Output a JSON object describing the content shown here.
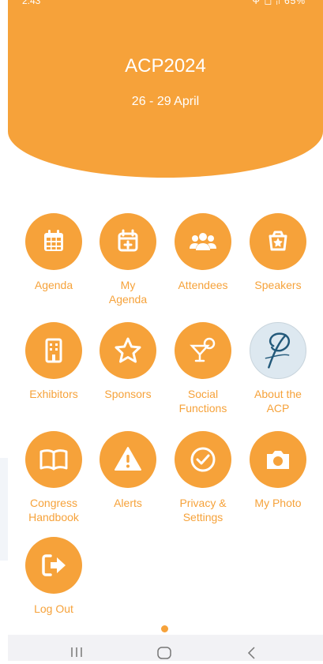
{
  "status_bar": {
    "time": "2:43",
    "right": "Ψ  ◻  ᵢₗ 65%"
  },
  "header": {
    "title": "ACP2024",
    "dates": "26 - 29 April"
  },
  "tiles": [
    {
      "label": "Agenda",
      "icon": "calendar-grid-icon"
    },
    {
      "label": "My\nAgenda",
      "icon": "calendar-plus-icon"
    },
    {
      "label": "Attendees",
      "icon": "users-group-icon"
    },
    {
      "label": "Speakers",
      "icon": "trophy-star-icon"
    },
    {
      "label": "Exhibitors",
      "icon": "building-icon"
    },
    {
      "label": "Sponsors",
      "icon": "star-icon"
    },
    {
      "label": "Social\nFunctions",
      "icon": "cocktail-icon"
    },
    {
      "label": "About the\nACP",
      "icon": "acp-logo"
    },
    {
      "label": "Congress\nHandbook",
      "icon": "book-open-icon"
    },
    {
      "label": "Alerts",
      "icon": "warning-icon"
    },
    {
      "label": "Privacy &\nSettings",
      "icon": "check-circle-icon"
    },
    {
      "label": "My Photo",
      "icon": "camera-icon"
    },
    {
      "label": "Log Out",
      "icon": "logout-icon"
    }
  ],
  "colors": {
    "accent": "#f6a23a",
    "background": "#ffffff",
    "nav_bar": "#f2f2f5"
  },
  "pagination": {
    "current": 1,
    "total": 1
  }
}
